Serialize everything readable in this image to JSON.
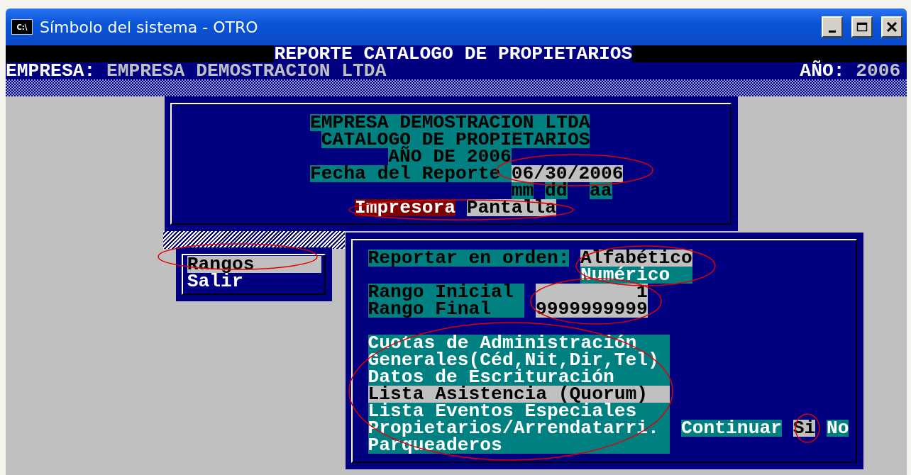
{
  "window": {
    "title": "Símbolo del sistema - OTRO",
    "icon_label": "C:\\"
  },
  "header": {
    "title": "REPORTE CATALOGO DE PROPIETARIOS",
    "company_label": "EMPRESA:",
    "company": "EMPRESA DEMOSTRACION LTDA",
    "year_label": "AÑO:",
    "year": "2006"
  },
  "report_dialog": {
    "lines": [
      "EMPRESA DEMOSTRACION LTDA",
      "CATALOGO DE PROPIETARIOS",
      "AÑO DE 2006"
    ],
    "date_label": "Fecha del Reporte",
    "date": "06/30/2006",
    "date_parts": [
      "mm",
      "dd",
      "aa"
    ],
    "outputs": [
      {
        "label": "Impresora",
        "selected": true
      },
      {
        "label": "Pantalla",
        "selected": false
      }
    ]
  },
  "menu": {
    "items": [
      {
        "label": "Rangos",
        "selected": true
      },
      {
        "label": "Salir",
        "selected": false
      }
    ]
  },
  "options_dialog": {
    "order_label": "Reportar en orden:",
    "order_options": [
      {
        "label": "Alfabético",
        "selected": true
      },
      {
        "label": "Numérico",
        "selected": false
      }
    ],
    "ranges": [
      {
        "label": "Rango Inicial",
        "value": "1"
      },
      {
        "label": "Rango Final",
        "value": "9999999999"
      }
    ],
    "reports": [
      {
        "label": "Cuotas de Administración",
        "selected": false
      },
      {
        "label": "Generales(Céd,Nit,Dir,Tel)",
        "selected": false
      },
      {
        "label": "Datos de Escrituración",
        "selected": false
      },
      {
        "label": "Lista Asistencia (Quorum)",
        "selected": true
      },
      {
        "label": "Lista Eventos Especiales",
        "selected": false
      },
      {
        "label": "Propietarios/Arrendatarri.",
        "selected": false
      },
      {
        "label": "Parqueaderos",
        "selected": false
      }
    ],
    "continue_label": "Continuar",
    "confirm": [
      {
        "label": "Si",
        "selected": true
      },
      {
        "label": "No",
        "selected": false
      }
    ]
  }
}
